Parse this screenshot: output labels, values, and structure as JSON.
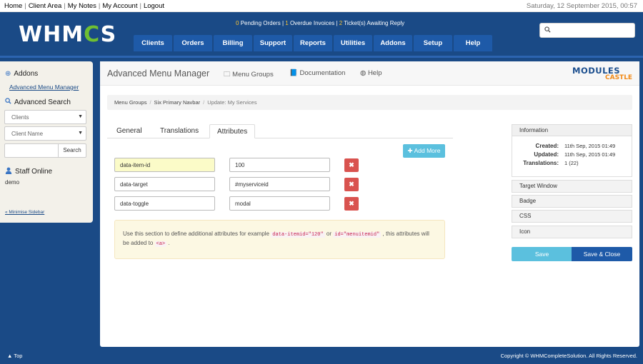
{
  "topbar": {
    "nav": [
      "Home",
      "Client Area",
      "My Notes",
      "My Account",
      "Logout"
    ],
    "datetime": "Saturday, 12 September 2015, 00:57"
  },
  "header": {
    "logo_prefix": "WHM",
    "logo_gear": "C",
    "logo_suffix": "S",
    "pending_count": "0",
    "pending_label": "Pending Orders",
    "overdue_count": "1",
    "overdue_label": "Overdue Invoices",
    "tickets_count": "2",
    "tickets_label": "Ticket(s) Awaiting Reply",
    "search_icon": "search-icon",
    "nav": [
      "Clients",
      "Orders",
      "Billing",
      "Support",
      "Reports",
      "Utilities",
      "Addons",
      "Setup",
      "Help"
    ]
  },
  "sidebar": {
    "addons_title": "Addons",
    "addons_link": "Advanced Menu Manager",
    "search_title": "Advanced Search",
    "select1": "Clients",
    "select2": "Client Name",
    "search_button": "Search",
    "staff_title": "Staff Online",
    "staff_user": "demo",
    "minimise": "« Minimise Sidebar"
  },
  "content": {
    "title": "Advanced Menu Manager",
    "link_menu_groups": "Menu Groups",
    "link_documentation": "Documentation",
    "link_help": "Help",
    "brand_line1": "MODULES",
    "brand_line2": "CASTLE",
    "breadcrumb": [
      "Menu Groups",
      "Six Primary Navbar",
      "Update: My Services"
    ],
    "tabs": [
      "General",
      "Translations",
      "Attributes"
    ],
    "active_tab": "Attributes",
    "add_more": "Add More",
    "attributes": [
      {
        "name": "data-item-id",
        "value": "100"
      },
      {
        "name": "data-target",
        "value": "#myserviceid"
      },
      {
        "name": "data-toggle",
        "value": "modal"
      }
    ],
    "info_text1": "Use this section to define additional attributes for example",
    "info_code1": "data-itemid=\"120\"",
    "info_or": "or",
    "info_code2": "id=\"menuitemid\"",
    "info_text2": ", this attributes will be added to",
    "info_code3": "<a>",
    "info_end": "."
  },
  "panel": {
    "info_title": "Information",
    "created_label": "Created:",
    "created_value": "11th Sep, 2015 01:49",
    "updated_label": "Updated:",
    "updated_value": "11th Sep, 2015 01:49",
    "translations_label": "Translations:",
    "translations_value": "1 (22)",
    "sections": [
      "Target Window",
      "Badge",
      "CSS",
      "Icon"
    ],
    "save": "Save",
    "save_close": "Save & Close"
  },
  "footer": {
    "top": "Top",
    "copyright": "Copyright © WHMCompleteSolution. All Rights Reserved."
  }
}
